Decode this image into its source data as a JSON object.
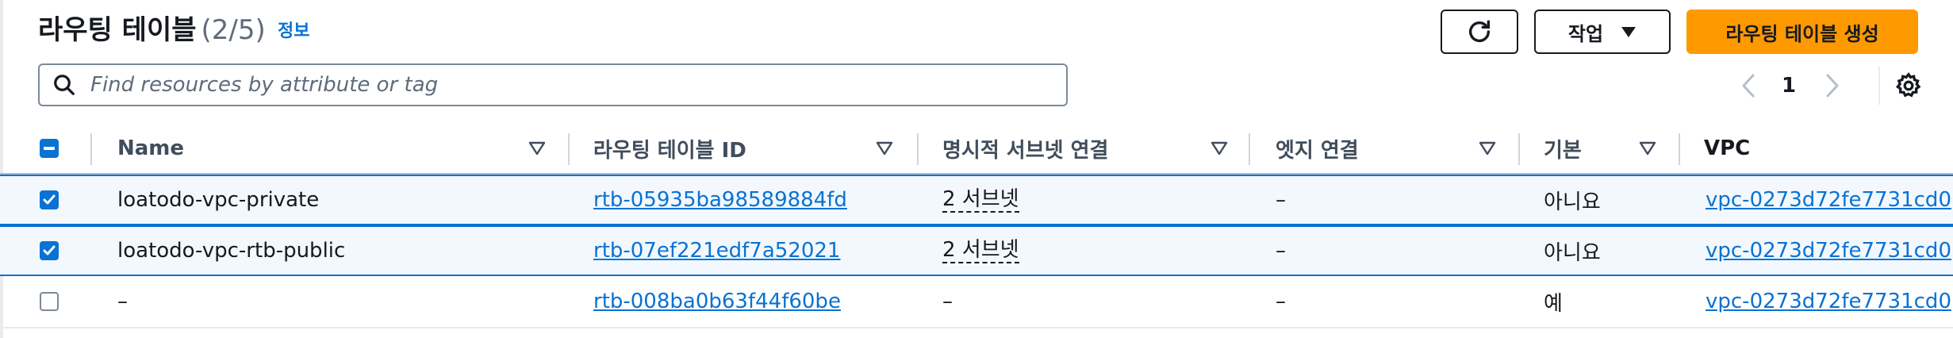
{
  "header": {
    "title": "라우팅 테이블",
    "count": "(2/5)",
    "info_link": "정보",
    "actions_label": "작업",
    "create_label": "라우팅 테이블 생성"
  },
  "search": {
    "placeholder": "Find resources by attribute or tag",
    "value": ""
  },
  "pagination": {
    "current_page": "1"
  },
  "table": {
    "columns": [
      "Name",
      "라우팅 테이블 ID",
      "명시적 서브넷 연결",
      "엣지 연결",
      "기본",
      "VPC"
    ],
    "rows": [
      {
        "selected": true,
        "name": "loatodo-vpc-private",
        "id": "rtb-05935ba98589884fd",
        "subnets": "2 서브넷",
        "edge": "–",
        "main": "아니요",
        "vpc": "vpc-0273d72fe7731cd0"
      },
      {
        "selected": true,
        "name": "loatodo-vpc-rtb-public",
        "id": "rtb-07ef221edf7a52021",
        "subnets": "2 서브넷",
        "edge": "–",
        "main": "아니요",
        "vpc": "vpc-0273d72fe7731cd0"
      },
      {
        "selected": false,
        "name": "–",
        "id": "rtb-008ba0b63f44f60be",
        "subnets": "–",
        "edge": "–",
        "main": "예",
        "vpc": "vpc-0273d72fe7731cd0"
      }
    ]
  },
  "colors": {
    "accent": "#0972d3",
    "primary_button": "#ff9900",
    "selected_row_bg": "#f2f8fd"
  }
}
